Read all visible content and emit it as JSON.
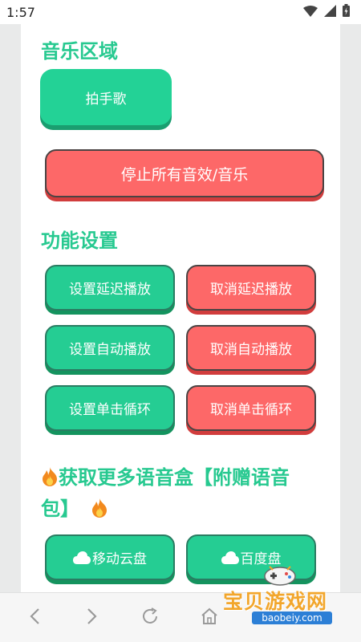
{
  "status_bar": {
    "time": "1:57"
  },
  "sections": {
    "music": {
      "title": "音乐区域"
    },
    "settings": {
      "title": "功能设置"
    },
    "more": {
      "title_line1": "获取更多语音盒【附赠语音",
      "title_line2": "包】"
    }
  },
  "buttons": {
    "clap_song": "拍手歌",
    "stop_all": "停止所有音效/音乐",
    "set_delay": "设置延迟播放",
    "cancel_delay": "取消延迟播放",
    "set_auto": "设置自动播放",
    "cancel_auto": "取消自动播放",
    "set_loop": "设置单击循环",
    "cancel_loop": "取消单击循环",
    "mobile_cloud": "移动云盘",
    "baidu_pan": "百度盘"
  },
  "watermark": {
    "brand": "宝贝游戏网",
    "url": "baobeiy.com"
  },
  "colors": {
    "accent_green": "#25cd93",
    "accent_red": "#fd6868",
    "title_green": "#27c990"
  },
  "icons": [
    "wifi-icon",
    "signal-icon",
    "battery-icon",
    "fire-icon",
    "cloud-icon",
    "back-icon",
    "forward-icon",
    "refresh-icon",
    "home-icon"
  ]
}
